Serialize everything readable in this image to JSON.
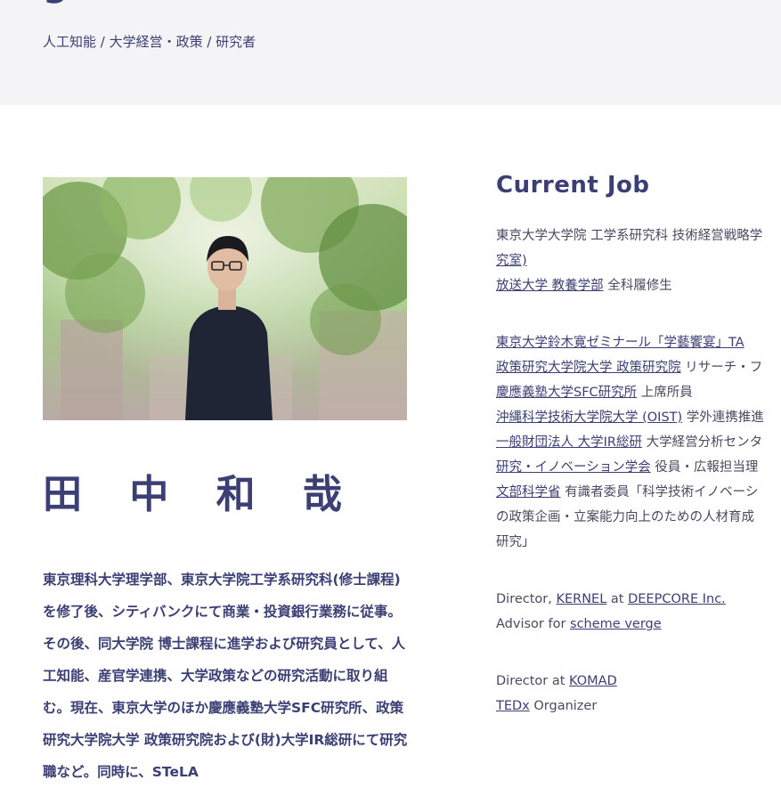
{
  "header": {
    "title_partial": "g",
    "fields": "人工知能 / 大学経営・政策 / 研究者"
  },
  "profile": {
    "name": "田 中 和 哉",
    "bio": "東京理科大学理学部、東京大学院工学系研究科(修士課程)を修了後、シティバンクにて商業・投資銀行業務に従事。その後、同大学院 博士課程に進学および研究員として、人工知能、産官学連携、大学政策などの研究活動に取り組む。現在、東京大学のほか慶應義塾大学SFC研究所、政策研究大学院大学 政策研究院および(財)大学IR総研にて研究職など。同時に、STeLA"
  },
  "current_job": {
    "title": "Current Job",
    "l1_a": "東京大学大学院 工学系研究科 技術経営戦略学",
    "l1_b": "究室)",
    "l2_link": "放送大学 教養学部",
    "l2_text": " 全科履修生",
    "l3_link": "東京大学鈴木寛ゼミナール「学藝饗宴」TA",
    "l4_link": "政策研究大学院大学 政策研究院",
    "l4_text": " リサーチ・フ",
    "l5_link": "慶應義塾大学SFC研究所",
    "l5_text": " 上席所員",
    "l6_link": "沖縄科学技術大学院大学 (OIST)",
    "l6_text": " 学外連携推進",
    "l7_link": "一般財団法人 大学IR総研",
    "l7_text": " 大学経営分析センタ",
    "l8_link": "研究・イノベーション学会",
    "l8_text": " 役員・広報担当理",
    "l9_link": "文部科学省",
    "l9_text": " 有識者委員「科学技術イノベーシ",
    "l10_text": "の政策企画・立案能力向上のための人材育成",
    "l11_text": "研究」",
    "d1_pre": "Director, ",
    "d1_link1": "KERNEL",
    "d1_mid": " at ",
    "d1_link2": "DEEPCORE Inc.",
    "d2_pre": "Advisor for ",
    "d2_link": "scheme verge",
    "d3_pre": "Director at ",
    "d3_link": "KOMAD",
    "d4_link": "TEDx",
    "d4_text": " Organizer"
  }
}
